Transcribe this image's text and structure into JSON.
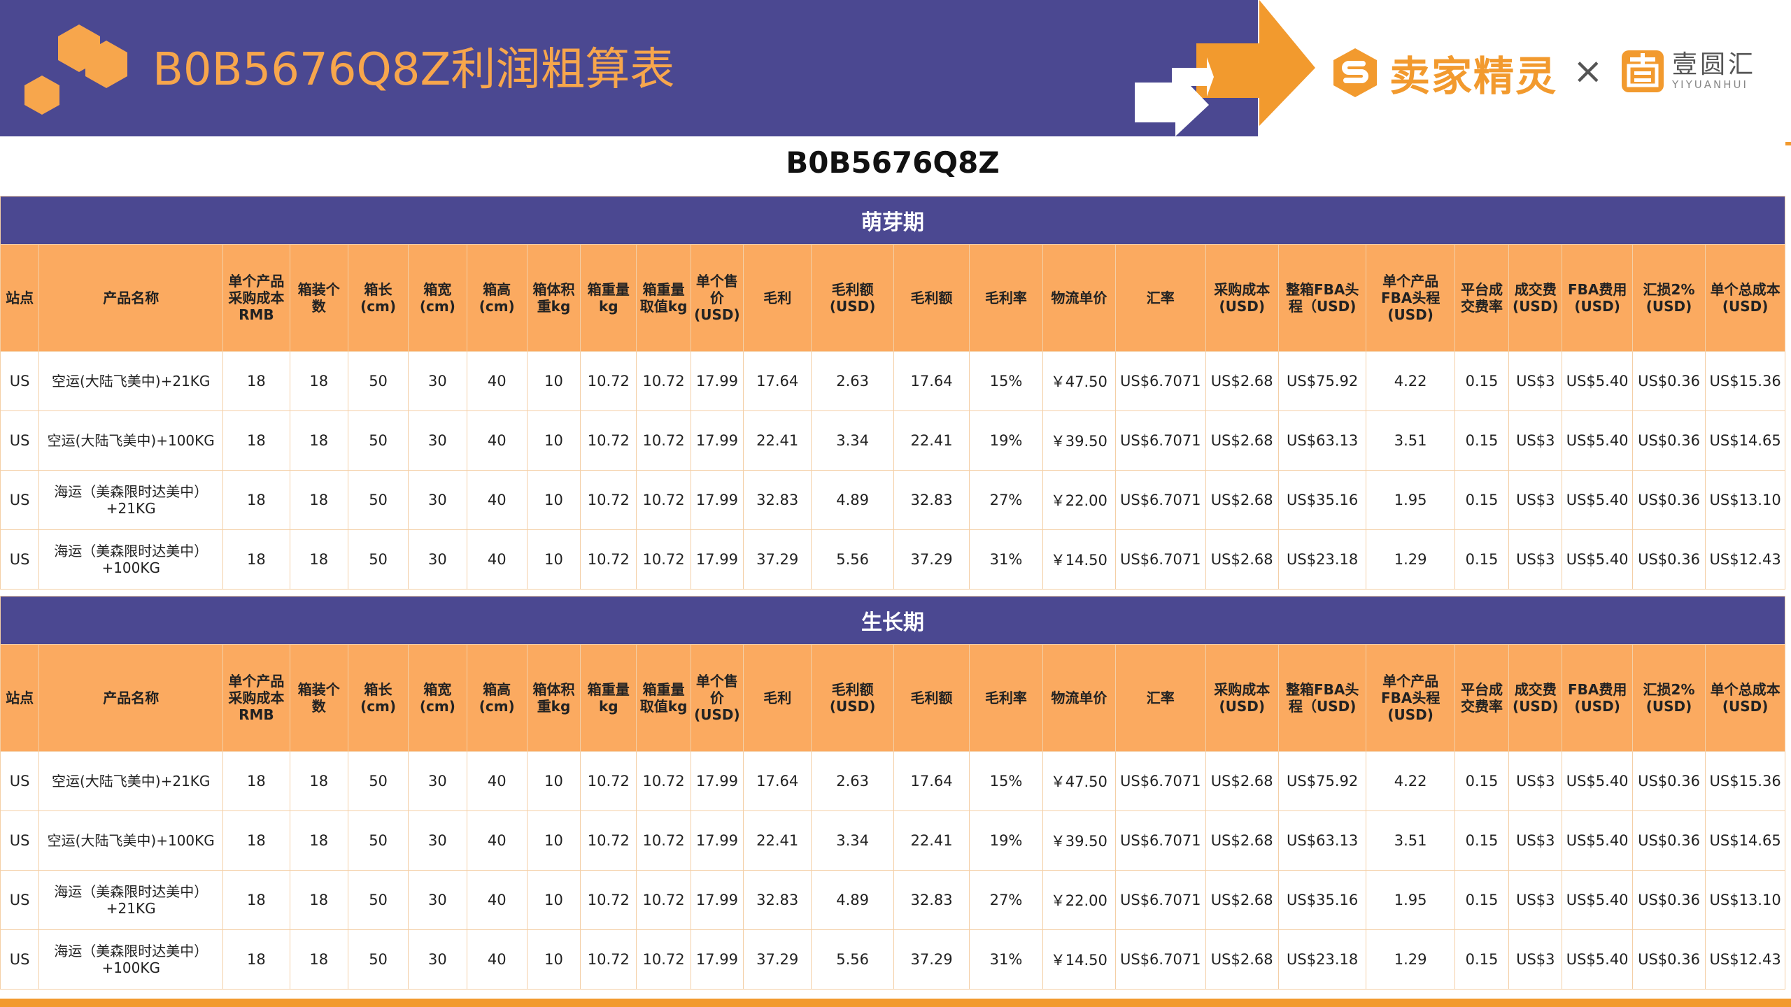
{
  "header": {
    "title": "B0B5676Q8Z利润粗算表",
    "brand1": "卖家精灵",
    "times": "×",
    "brand2_cn": "壹圆汇",
    "brand2_en": "YIYUANHUI"
  },
  "asin_heading": "B0B5676Q8Z",
  "columns": [
    "站点",
    "产品名称",
    "单个产品采购成本RMB",
    "箱装个数",
    "箱长(cm)",
    "箱宽(cm)",
    "箱高(cm)",
    "箱体积重kg",
    "箱重量kg",
    "箱重量取值kg",
    "单个售价(USD)",
    "毛利",
    "毛利额(USD)",
    "毛利额",
    "毛利率",
    "物流单价",
    "汇率",
    "采购成本(USD)",
    "整箱FBA头程（USD)",
    "单个产品FBA头程(USD)",
    "平台成交费率",
    "成交费(USD)",
    "FBA费用(USD)",
    "汇损2%(USD)",
    "单个总成本(USD)"
  ],
  "sections": [
    {
      "phase": "萌芽期",
      "rows": [
        [
          "US",
          "空运(大陆飞美中)+21KG",
          "18",
          "18",
          "50",
          "30",
          "40",
          "10",
          "10.72",
          "10.72",
          "17.99",
          "17.64",
          "2.63",
          "17.64",
          "15%",
          "￥47.50",
          "US$6.7071",
          "US$2.68",
          "US$75.92",
          "4.22",
          "0.15",
          "US$3",
          "US$5.40",
          "US$0.36",
          "US$15.36"
        ],
        [
          "US",
          "空运(大陆飞美中)+100KG",
          "18",
          "18",
          "50",
          "30",
          "40",
          "10",
          "10.72",
          "10.72",
          "17.99",
          "22.41",
          "3.34",
          "22.41",
          "19%",
          "￥39.50",
          "US$6.7071",
          "US$2.68",
          "US$63.13",
          "3.51",
          "0.15",
          "US$3",
          "US$5.40",
          "US$0.36",
          "US$14.65"
        ],
        [
          "US",
          "海运（美森限时达美中）+21KG",
          "18",
          "18",
          "50",
          "30",
          "40",
          "10",
          "10.72",
          "10.72",
          "17.99",
          "32.83",
          "4.89",
          "32.83",
          "27%",
          "￥22.00",
          "US$6.7071",
          "US$2.68",
          "US$35.16",
          "1.95",
          "0.15",
          "US$3",
          "US$5.40",
          "US$0.36",
          "US$13.10"
        ],
        [
          "US",
          "海运（美森限时达美中）+100KG",
          "18",
          "18",
          "50",
          "30",
          "40",
          "10",
          "10.72",
          "10.72",
          "17.99",
          "37.29",
          "5.56",
          "37.29",
          "31%",
          "￥14.50",
          "US$6.7071",
          "US$2.68",
          "US$23.18",
          "1.29",
          "0.15",
          "US$3",
          "US$5.40",
          "US$0.36",
          "US$12.43"
        ]
      ]
    },
    {
      "phase": "生长期",
      "rows": [
        [
          "US",
          "空运(大陆飞美中)+21KG",
          "18",
          "18",
          "50",
          "30",
          "40",
          "10",
          "10.72",
          "10.72",
          "17.99",
          "17.64",
          "2.63",
          "17.64",
          "15%",
          "￥47.50",
          "US$6.7071",
          "US$2.68",
          "US$75.92",
          "4.22",
          "0.15",
          "US$3",
          "US$5.40",
          "US$0.36",
          "US$15.36"
        ],
        [
          "US",
          "空运(大陆飞美中)+100KG",
          "18",
          "18",
          "50",
          "30",
          "40",
          "10",
          "10.72",
          "10.72",
          "17.99",
          "22.41",
          "3.34",
          "22.41",
          "19%",
          "￥39.50",
          "US$6.7071",
          "US$2.68",
          "US$63.13",
          "3.51",
          "0.15",
          "US$3",
          "US$5.40",
          "US$0.36",
          "US$14.65"
        ],
        [
          "US",
          "海运（美森限时达美中）+21KG",
          "18",
          "18",
          "50",
          "30",
          "40",
          "10",
          "10.72",
          "10.72",
          "17.99",
          "32.83",
          "4.89",
          "32.83",
          "27%",
          "￥22.00",
          "US$6.7071",
          "US$2.68",
          "US$35.16",
          "1.95",
          "0.15",
          "US$3",
          "US$5.40",
          "US$0.36",
          "US$13.10"
        ],
        [
          "US",
          "海运（美森限时达美中）+100KG",
          "18",
          "18",
          "50",
          "30",
          "40",
          "10",
          "10.72",
          "10.72",
          "17.99",
          "37.29",
          "5.56",
          "37.29",
          "31%",
          "￥14.50",
          "US$6.7071",
          "US$2.68",
          "US$23.18",
          "1.29",
          "0.15",
          "US$3",
          "US$5.40",
          "US$0.36",
          "US$12.43"
        ]
      ]
    }
  ],
  "colors": {
    "banner": "#4b4891",
    "accent_orange": "#f29a2e",
    "header_orange": "#fbaa60",
    "title_orange": "#f7a64c"
  }
}
